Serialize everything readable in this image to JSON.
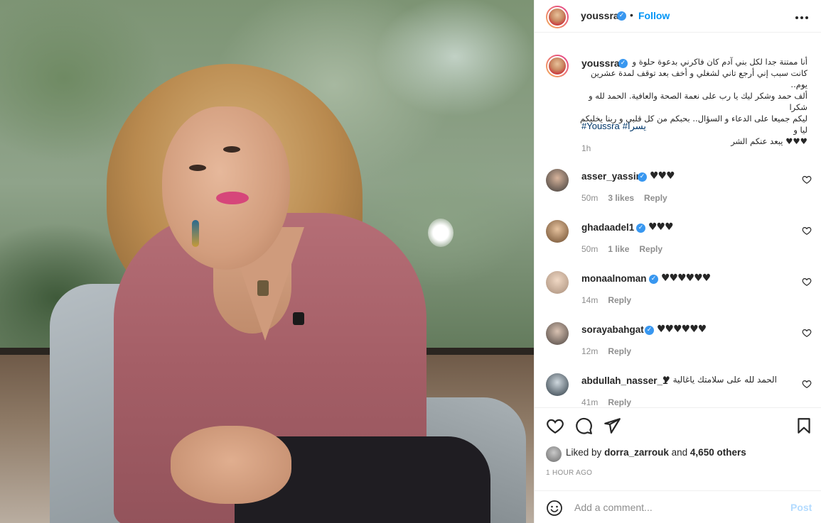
{
  "header": {
    "username": "youssra",
    "dot": "•",
    "follow_label": "Follow",
    "more_icon": "more-horizontal-icon"
  },
  "caption": {
    "username": "youssra",
    "lines": [
      "أنا ممتنة جدا لكل بني آدم كان فاكرني بدعوة حلوة و",
      "كانت سبب إني أرجع تاني لشغلي و أخف بعد توقف لمدة عشرين يوم..",
      "ألف حمد وشكر ليك يا رب على نعمة الصحة والعافية. الحمد لله و شكرا",
      "ليكم جميعا على الدعاء و السؤال.. بحبكم من كل قلبي و ربنا يخليكم ليا و",
      "♥♥♥ يبعد عنكم الشر"
    ],
    "hashtags": [
      "#Youssra",
      "#يسرا"
    ],
    "time": "1h"
  },
  "comments": [
    {
      "username": "asser_yassin",
      "text": "♥♥♥",
      "time": "50m",
      "likes": "3 likes",
      "reply": "Reply"
    },
    {
      "username": "ghadaadel1",
      "text": "♥♥♥",
      "time": "50m",
      "likes": "1 like",
      "reply": "Reply"
    },
    {
      "username": "monaalnoman",
      "text": "♥♥♥♥♥♥",
      "time": "14m",
      "reply": "Reply"
    },
    {
      "username": "sorayabahgat",
      "text": "♥♥♥♥♥♥",
      "time": "12m",
      "reply": "Reply"
    },
    {
      "username": "abdullah_nasser_1",
      "text": "الحمد لله على سلامتك ياغالية ♥",
      "time": "41m",
      "likes": "",
      "reply": "Reply"
    }
  ],
  "actions": {
    "liked_by_prefix": "Liked by",
    "liked_by_user": "dorra_zarrouk",
    "liked_by_and": "and",
    "liked_by_others": "4,650 others",
    "timestamp": "1 HOUR AGO"
  },
  "add_comment": {
    "placeholder": "Add a comment...",
    "post_label": "Post"
  },
  "colors": {
    "accent": "#0095f6",
    "verified": "#3897f0",
    "post_disabled": "#b3dbff",
    "meta_gray": "#8e8e8e"
  }
}
